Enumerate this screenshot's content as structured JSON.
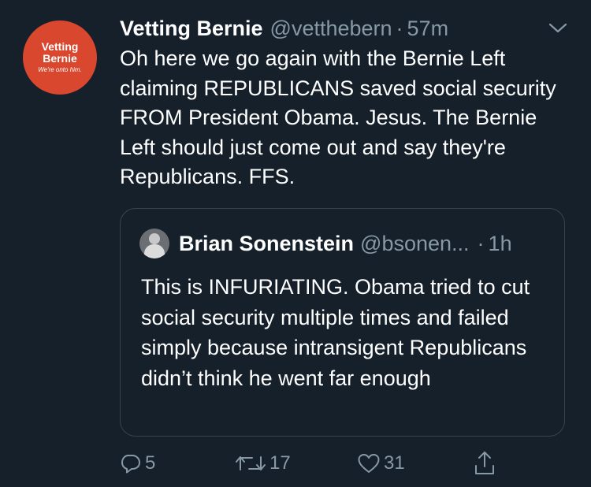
{
  "tweet": {
    "author": {
      "name": "Vetting Bernie",
      "handle": "@vetthebern",
      "avatar_line1": "Vetting",
      "avatar_line2": "Bernie",
      "avatar_tagline": "We're onto him.",
      "avatar_color": "#d9472f"
    },
    "separator": "·",
    "time": "57m",
    "text": "Oh here we go again with the Bernie Left claiming REPUBLICANS saved social security FROM President Obama. Jesus. The Bernie Left should just come out and say they're Republicans. FFS.",
    "menu_icon": "chevron-down-icon"
  },
  "quoted_tweet": {
    "name": "Brian Sonenstein",
    "handle": "@bsonen...",
    "separator": "·",
    "time": "1h",
    "text": "This is INFURIATING. Obama tried to cut social security multiple times and failed simply because intransigent Republicans didn’t think he went far enough"
  },
  "actions": {
    "reply": {
      "icon": "reply-icon",
      "count": "5"
    },
    "retweet": {
      "icon": "retweet-icon",
      "count": "17"
    },
    "like": {
      "icon": "heart-icon",
      "count": "31"
    },
    "share": {
      "icon": "share-icon"
    }
  },
  "colors": {
    "background": "#15202b",
    "secondary_text": "#8899a6",
    "border": "#38444d"
  }
}
